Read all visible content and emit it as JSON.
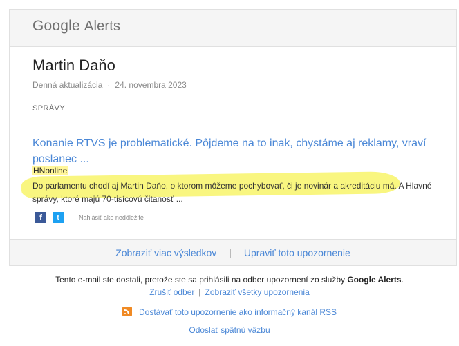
{
  "header": {
    "logo_google": "Google",
    "logo_alerts": "Alerts"
  },
  "alert": {
    "title": "Martin Daňo",
    "frequency": "Denná aktualizácia",
    "separator": "·",
    "date": "24. novembra 2023",
    "section": "SPRÁVY"
  },
  "article": {
    "title": "Konanie RTVS je problematické. Pôjdeme na to inak, chystáme aj reklamy, vraví poslanec ...",
    "source": "HNonline",
    "snippet_before": "Do parlamentu chodí aj ",
    "snippet_bold": "Martin Daňo",
    "snippet_after": ", o ktorom môžeme pochybovať, či je novinár a akreditáciu má. A Hlavné správy, ktoré majú 70-tisícovú čitanosť ...",
    "flag_label": "Nahlásiť ako nedôležité"
  },
  "social": {
    "facebook_glyph": "f",
    "twitter_glyph": "t"
  },
  "footer": {
    "more_results": "Zobraziť viac výsledkov",
    "separator": "|",
    "edit_alert": "Upraviť toto upozornenie"
  },
  "notice": {
    "text": "Tento e-mail ste dostali, pretože ste sa prihlásili na odber upozornení zo služby ",
    "brand": "Google Alerts",
    "end": "."
  },
  "links": {
    "unsubscribe": "Zrušiť odber",
    "separator": "|",
    "view_all": "Zobraziť všetky upozornenia"
  },
  "rss": {
    "label": "Dostávať toto upozornenie ako informačný kanál RSS"
  },
  "feedback": {
    "label": "Odoslať spätnú väzbu"
  },
  "colors": {
    "link": "#4a87d6",
    "highlight": "#f8f56a",
    "facebook": "#3b5998",
    "twitter": "#1da1f2",
    "rss": "#f08a24"
  }
}
